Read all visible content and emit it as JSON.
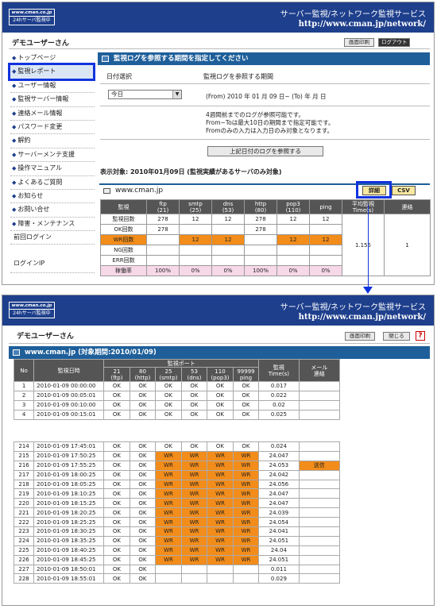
{
  "top": {
    "header": {
      "logo_top": "www.cman.co.jp",
      "logo_bottom": "24hサーバ監視中",
      "service": "サーバー監視/ネットワーク監視サービス",
      "url": "http://www.cman.jp/network/"
    },
    "user": "デモユーザーさん",
    "print_button": "画面印刷",
    "logout_button": "ログアウト",
    "sidebar": [
      "トップページ",
      "監視レポート",
      "ユーザー情報",
      "監視サーバー情報",
      "連絡メール情報",
      "パスワード変更",
      "解約",
      "サーバーメンテ支援",
      "操作マニュアル",
      "よくあるご質問",
      "お知らせ",
      "お問い合せ",
      "障害・メンテナンス"
    ],
    "sidebar_plain": [
      "前回ログイン",
      "ログインIP"
    ],
    "section_title": "監視ログを参照する期間を指定してください",
    "date_label": "日付選択",
    "period_label": "監視ログを参照する期間",
    "select_value": "今日",
    "period_text": "(From) 2010 年  01 月  09 日~ (To)        年        月        日",
    "notes": [
      "4週間前までのログが参照可能です。",
      "From~Toは最大10日の期間まで指定可能です。",
      "Fromのみの入力は入力日のみ対象となります。"
    ],
    "view_button": "上記日付のログを参照する",
    "target": "表示対象: 2010年01月09日 (監視実績があるサーバのみ対象)",
    "server": "www.cman.jp",
    "detail_button": "詳細",
    "csv_button": "CSV",
    "table": {
      "headers": [
        "監視",
        "ftp\n(21)",
        "smtp\n(25)",
        "dns\n(53)",
        "http\n(80)",
        "pop3\n(110)",
        "ping",
        "平均監視\nTime(s)",
        "連絡"
      ],
      "rows": [
        [
          "監視回数",
          "278",
          "12",
          "12",
          "278",
          "12",
          "12"
        ],
        [
          "OK回数",
          "278",
          "",
          "",
          "278",
          "",
          ""
        ],
        [
          "WR回数",
          "",
          "12",
          "12",
          "",
          "12",
          "12"
        ],
        [
          "NG回数",
          "",
          "",
          "",
          "",
          "",
          ""
        ],
        [
          "ERR回数",
          "",
          "",
          "",
          "",
          "",
          ""
        ],
        [
          "稼働率",
          "100%",
          "0%",
          "0%",
          "100%",
          "0%",
          "0%"
        ]
      ],
      "avg": "1.155",
      "contact": "1"
    }
  },
  "bottom": {
    "header": {
      "logo_top": "www.cman.co.jp",
      "logo_bottom": "24hサーバ監視中",
      "service": "サーバー監視/ネットワーク監視サービス",
      "url": "http://www.cman.jp/network/"
    },
    "user": "デモユーザーさん",
    "print_button": "画面印刷",
    "close_button": "閉じる",
    "help": "?",
    "title": "www.cman.jp (対象期間:2010/01/09)",
    "headers": {
      "no": "No",
      "date": "監視日時",
      "ports": "監視ポート",
      "cols": [
        "21\n(ftp)",
        "80\n(http)",
        "25\n(smtp)",
        "53\n(dns)",
        "110\n(pop3)",
        "99999\nping"
      ],
      "time": "監視\nTime(s)",
      "mail": "メール\n連絡"
    },
    "rows_a": [
      [
        "1",
        "2010-01-09 00:00:00",
        "OK",
        "OK",
        "OK",
        "OK",
        "OK",
        "OK",
        "0.017",
        ""
      ],
      [
        "2",
        "2010-01-09 00:05:01",
        "OK",
        "OK",
        "OK",
        "OK",
        "OK",
        "OK",
        "0.022",
        ""
      ],
      [
        "3",
        "2010-01-09 00:10:00",
        "OK",
        "OK",
        "OK",
        "OK",
        "OK",
        "OK",
        "0.02",
        ""
      ],
      [
        "4",
        "2010-01-09 00:15:01",
        "OK",
        "OK",
        "OK",
        "OK",
        "OK",
        "OK",
        "0.025",
        ""
      ]
    ],
    "rows_b": [
      [
        "214",
        "2010-01-09 17:45:01",
        "OK",
        "OK",
        "OK",
        "OK",
        "OK",
        "OK",
        "0.024",
        ""
      ],
      [
        "215",
        "2010-01-09 17:50:25",
        "OK",
        "OK",
        "WR",
        "WR",
        "WR",
        "WR",
        "24.047",
        ""
      ],
      [
        "216",
        "2010-01-09 17:55:25",
        "OK",
        "OK",
        "WR",
        "WR",
        "WR",
        "WR",
        "24.053",
        "送信"
      ],
      [
        "217",
        "2010-01-09 18:00:25",
        "OK",
        "OK",
        "WR",
        "WR",
        "WR",
        "WR",
        "24.042",
        ""
      ],
      [
        "218",
        "2010-01-09 18:05:25",
        "OK",
        "OK",
        "WR",
        "WR",
        "WR",
        "WR",
        "24.056",
        ""
      ],
      [
        "219",
        "2010-01-09 18:10:25",
        "OK",
        "OK",
        "WR",
        "WR",
        "WR",
        "WR",
        "24.047",
        ""
      ],
      [
        "220",
        "2010-01-09 18:15:25",
        "OK",
        "OK",
        "WR",
        "WR",
        "WR",
        "WR",
        "24.047",
        ""
      ],
      [
        "221",
        "2010-01-09 18:20:25",
        "OK",
        "OK",
        "WR",
        "WR",
        "WR",
        "WR",
        "24.039",
        ""
      ],
      [
        "222",
        "2010-01-09 18:25:25",
        "OK",
        "OK",
        "WR",
        "WR",
        "WR",
        "WR",
        "24.054",
        ""
      ],
      [
        "223",
        "2010-01-09 18:30:25",
        "OK",
        "OK",
        "WR",
        "WR",
        "WR",
        "WR",
        "24.041",
        ""
      ],
      [
        "224",
        "2010-01-09 18:35:25",
        "OK",
        "OK",
        "WR",
        "WR",
        "WR",
        "WR",
        "24.051",
        ""
      ],
      [
        "225",
        "2010-01-09 18:40:25",
        "OK",
        "OK",
        "WR",
        "WR",
        "WR",
        "WR",
        "24.04",
        ""
      ],
      [
        "226",
        "2010-01-09 18:45:25",
        "OK",
        "OK",
        "WR",
        "WR",
        "WR",
        "WR",
        "24.051",
        ""
      ],
      [
        "227",
        "2010-01-09 18:50:01",
        "OK",
        "OK",
        "",
        "",
        "",
        "",
        "0.011",
        ""
      ],
      [
        "228",
        "2010-01-09 18:55:01",
        "OK",
        "OK",
        "",
        "",
        "",
        "",
        "0.029",
        ""
      ]
    ]
  },
  "colors": {
    "header_bg": "#1e3f8c",
    "section_bg": "#1e5f9a",
    "warn": "#f28c1a",
    "highlight": "#1133dd",
    "rate_bg": "#f7d8e8"
  }
}
